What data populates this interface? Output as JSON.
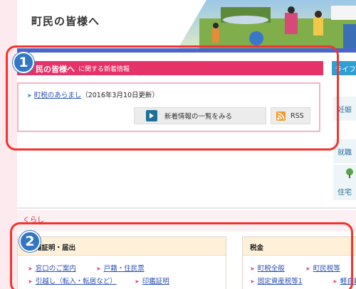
{
  "header": {
    "title": "町民の皆様へ"
  },
  "news": {
    "band_title": "民の皆様へ",
    "band_sub": "に関する新着情報",
    "item_link": "町税のあらまし",
    "item_date": "（2016年3月10日更新）",
    "list_button": "新着情報の一覧をみる",
    "rss_button": "RSS"
  },
  "side": {
    "tab": "ライフ",
    "cards": [
      "妊娠",
      "就職",
      "住宅"
    ]
  },
  "section": {
    "label": "くらし"
  },
  "cards": [
    {
      "title": "籍証明・届出",
      "links": [
        "窓口のご案内",
        "戸籍・住民票",
        "引越し（転入・転居など）",
        "印鑑証明"
      ]
    },
    {
      "title": "税金",
      "links": [
        "町税全般",
        "町民税等",
        "固定資産税等1",
        "軽自動"
      ]
    }
  ],
  "callouts": [
    "1",
    "2"
  ],
  "colors": {
    "accent_pink": "#e5336a",
    "header_blue": "#4a66c8",
    "callout_red": "#f1342d",
    "badge_blue": "#3276c4"
  }
}
